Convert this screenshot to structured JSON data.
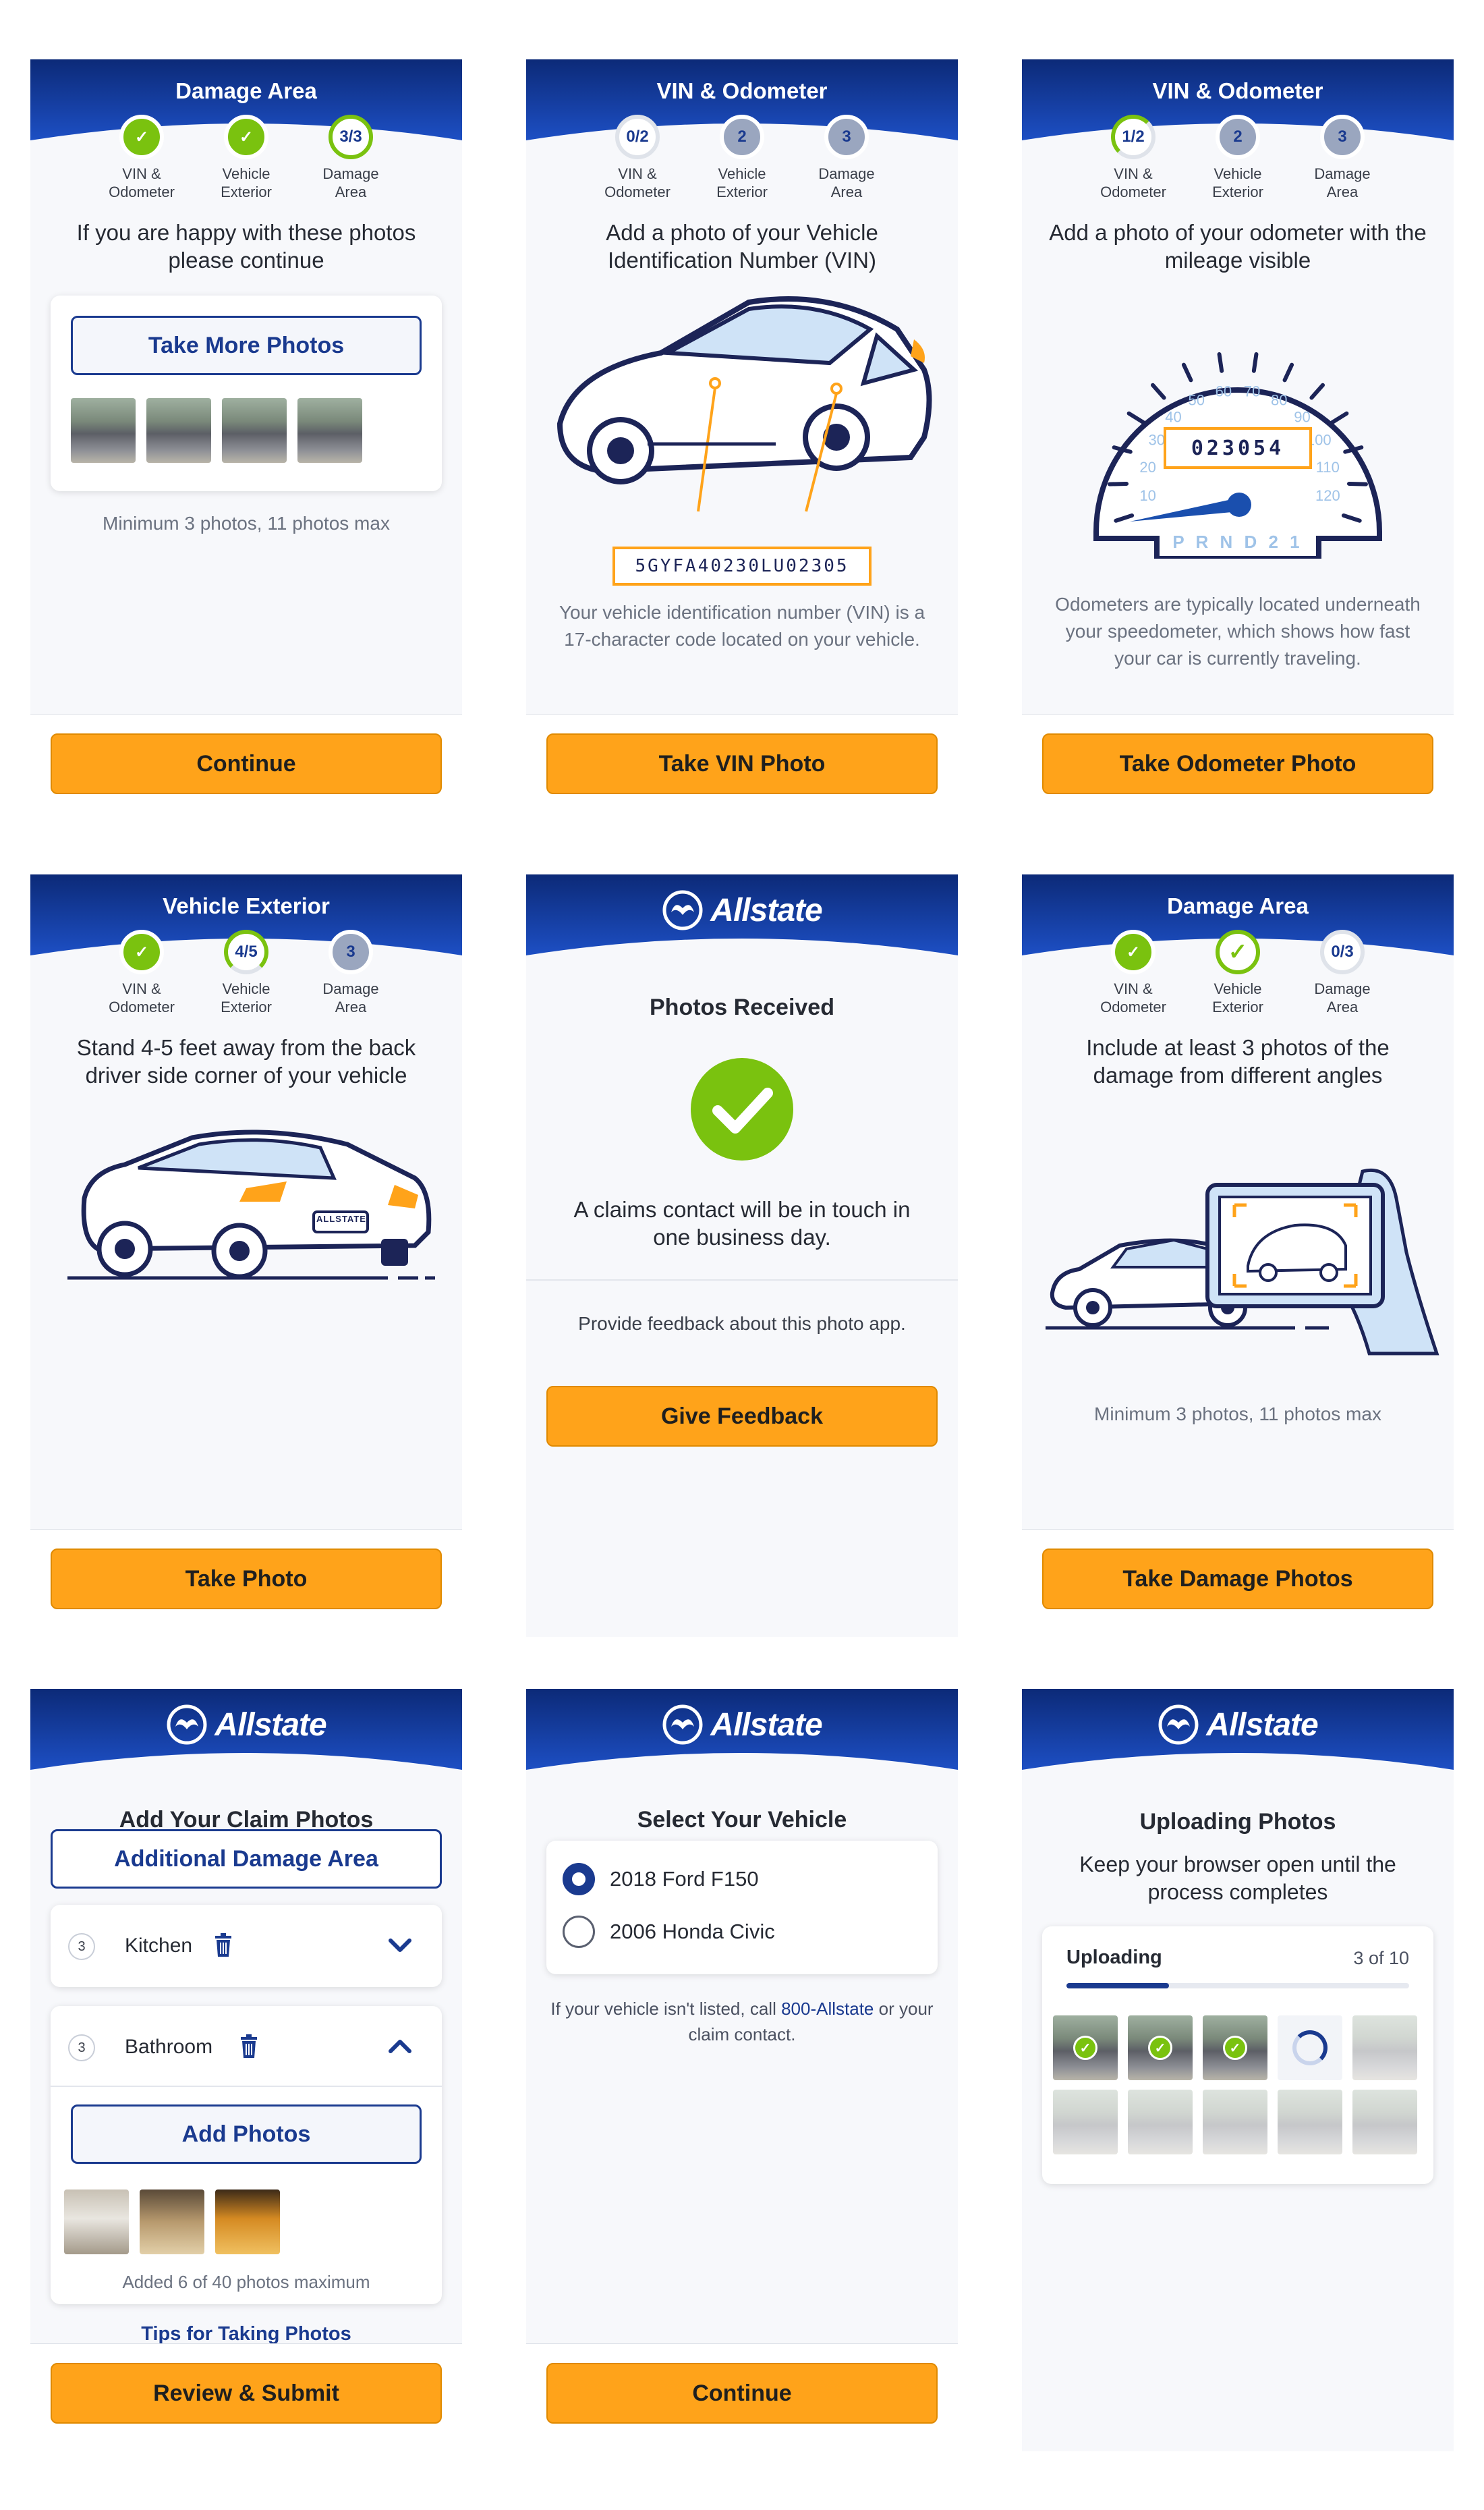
{
  "screens": {
    "s1": {
      "title": "Damage Area",
      "steps": [
        {
          "circle": "✓",
          "label": "VIN &\nOdometer"
        },
        {
          "circle": "✓",
          "label": "Vehicle\nExterior"
        },
        {
          "circle": "3/3",
          "label": "Damage\nArea"
        }
      ],
      "prompt": "If you are happy with these photos please continue",
      "take_more_label": "Take More Photos",
      "note": "Minimum 3 photos, 11 photos max",
      "button": "Continue"
    },
    "s2": {
      "title": "VIN & Odometer",
      "steps": [
        {
          "circle": "0/2",
          "label": "VIN &\nOdometer"
        },
        {
          "circle": "2",
          "label": "Vehicle\nExterior"
        },
        {
          "circle": "3",
          "label": "Damage\nArea"
        }
      ],
      "prompt": "Add a photo of your Vehicle Identification Number (VIN)",
      "vin": "5GYFA40230LU02305",
      "note": "Your vehicle identification number (VIN) is a 17-character code located on your vehicle.",
      "button": "Take VIN Photo"
    },
    "s3": {
      "title": "VIN & Odometer",
      "steps": [
        {
          "circle": "1/2",
          "label": "VIN &\nOdometer"
        },
        {
          "circle": "2",
          "label": "Vehicle\nExterior"
        },
        {
          "circle": "3",
          "label": "Damage\nArea"
        }
      ],
      "prompt": "Add a photo of your odometer with the mileage visible",
      "odometer": "023054",
      "gauge_labels": [
        "10",
        "20",
        "30",
        "40",
        "50",
        "60",
        "70",
        "80",
        "90",
        "100",
        "110",
        "120"
      ],
      "gear": "P R N D 2 1",
      "note": "Odometers are typically located underneath your speedometer, which shows how fast your car is currently traveling.",
      "button": "Take Odometer Photo"
    },
    "s4": {
      "title": "Vehicle Exterior",
      "steps": [
        {
          "circle": "✓",
          "label": "VIN &\nOdometer"
        },
        {
          "circle": "4/5",
          "label": "Vehicle\nExterior"
        },
        {
          "circle": "3",
          "label": "Damage\nArea"
        }
      ],
      "prompt": "Stand 4-5 feet away from the back driver side corner of your vehicle",
      "plate": "ALLSTATE",
      "button": "Take Photo"
    },
    "s5": {
      "brand": "Allstate",
      "heading": "Photos Received",
      "message": "A claims contact will be in touch in one business day.",
      "feedback_prompt": "Provide feedback about this photo app.",
      "button": "Give Feedback"
    },
    "s6": {
      "title": "Damage Area",
      "steps": [
        {
          "circle": "✓",
          "label": "VIN &\nOdometer"
        },
        {
          "circle": "✓",
          "label": "Vehicle\nExterior"
        },
        {
          "circle": "0/3",
          "label": "Damage\nArea"
        }
      ],
      "prompt": "Include at least 3 photos of the damage from different angles",
      "note": "Minimum 3 photos, 11 photos max",
      "button": "Take Damage Photos"
    },
    "s7": {
      "brand": "Allstate",
      "heading": "Add Your Claim Photos",
      "additional_label": "Additional Damage Area",
      "areas": [
        {
          "count": "3",
          "name": "Kitchen"
        },
        {
          "count": "3",
          "name": "Bathroom"
        }
      ],
      "add_photos_label": "Add Photos",
      "added_note": "Added 6 of 40 photos maximum",
      "tips_link": "Tips for Taking Photos",
      "button": "Review & Submit"
    },
    "s8": {
      "brand": "Allstate",
      "heading": "Select Your Vehicle",
      "vehicles": [
        "2018 Ford F150",
        "2006 Honda Civic"
      ],
      "selected_index": 0,
      "note_before": "If your vehicle isn't listed, call",
      "note_link": "800-Allstate",
      "note_after": "or your claim contact.",
      "button": "Continue"
    },
    "s9": {
      "brand": "Allstate",
      "heading": "Uploading Photos",
      "message": "Keep your browser open until the process completes",
      "status_label": "Uploading",
      "count": "3 of 10",
      "progress": 0.3
    }
  },
  "colors": {
    "navy": "#1a3a8f",
    "orange": "#ffa31a",
    "green": "#7ac20f"
  }
}
